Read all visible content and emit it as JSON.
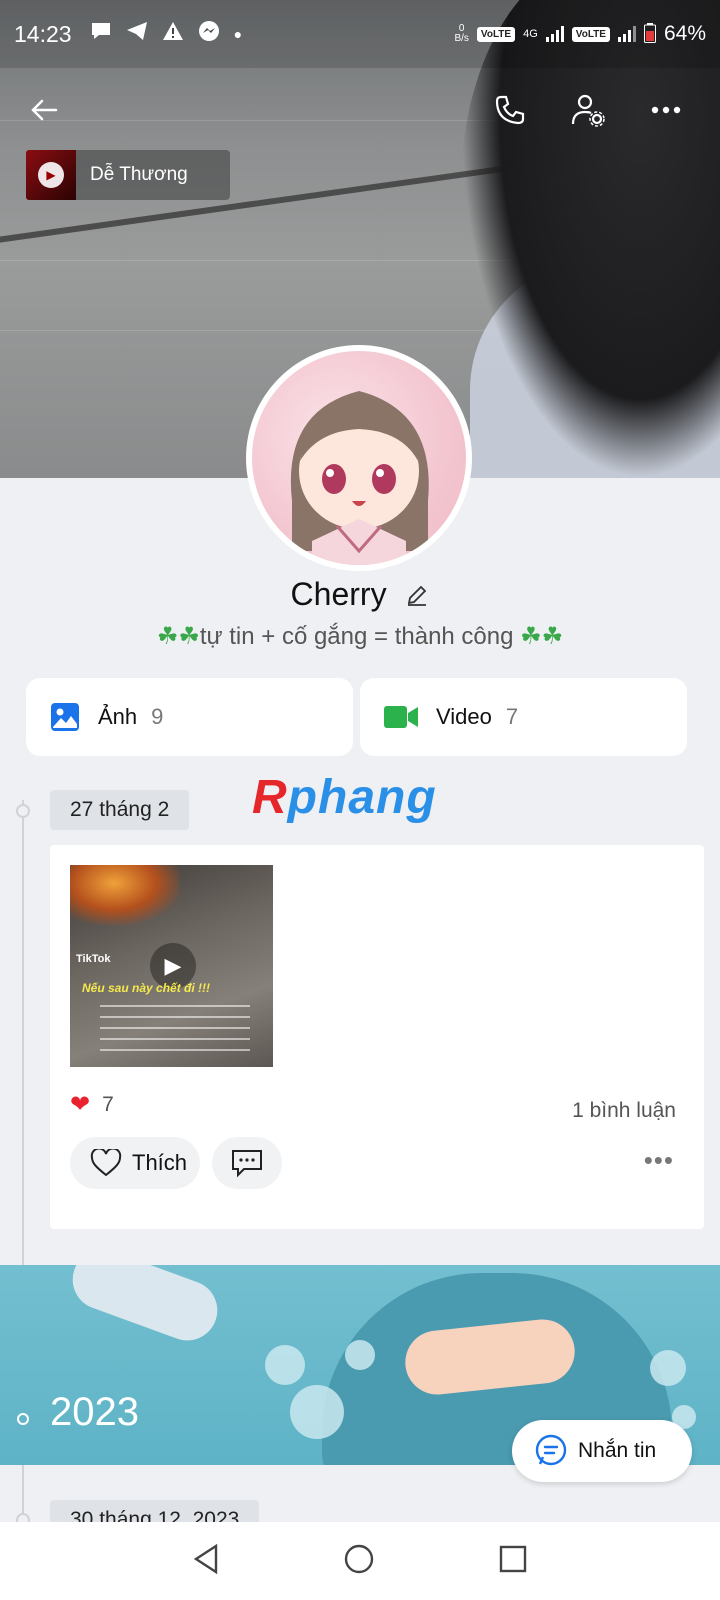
{
  "status_bar": {
    "time": "14:23",
    "net_speed_top": "0",
    "net_speed_bottom": "B/s",
    "volte1": "VoLTE",
    "network": "4G",
    "volte2": "VoLTE",
    "battery": "64%"
  },
  "music": {
    "title": "Dễ Thương"
  },
  "profile": {
    "name": "Cherry",
    "bio_prefix": "☘☘",
    "bio_text": "tự tin + cố gắng = thành công ",
    "bio_suffix": "☘☘"
  },
  "tiles": {
    "photos_label": "Ảnh",
    "photos_count": "9",
    "videos_label": "Video",
    "videos_count": "7"
  },
  "watermark": {
    "first": "R",
    "rest": "phang"
  },
  "timeline": {
    "date1": "27 tháng 2",
    "post": {
      "tiktok_label": "TikTok",
      "caption": "Nếu sau này chết đi !!!",
      "reaction_count": "7",
      "comments": "1 bình luận",
      "like_label": "Thích"
    },
    "year": "2023",
    "date2": "30 tháng 12, 2023"
  },
  "message_button": {
    "label": "Nhắn tin"
  },
  "colors": {
    "accent_blue": "#1a73e8",
    "video_green": "#2bb24c",
    "heart": "#e8232e"
  }
}
